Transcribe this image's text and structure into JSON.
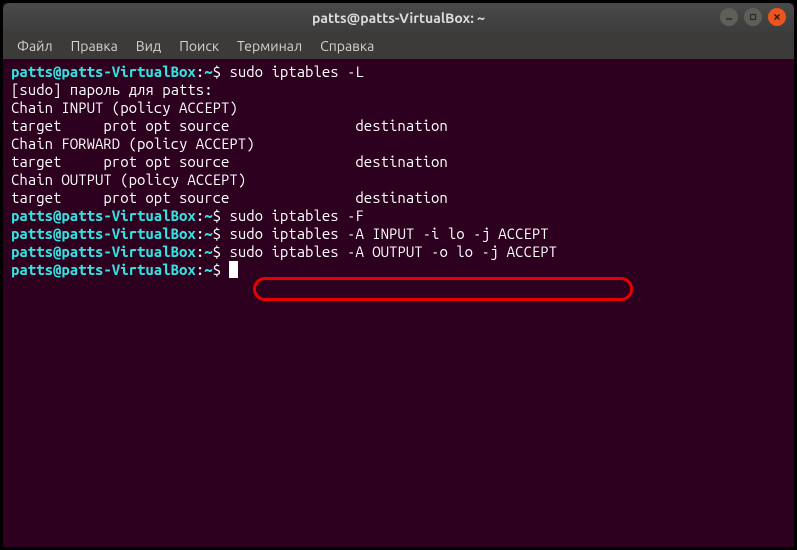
{
  "titlebar": {
    "title": "patts@patts-VirtualBox: ~"
  },
  "menubar": {
    "items": [
      "Файл",
      "Правка",
      "Вид",
      "Поиск",
      "Терминал",
      "Справка"
    ]
  },
  "prompt": {
    "user_host": "patts@patts-VirtualBox",
    "sep": ":",
    "path": "~",
    "sym": "$"
  },
  "lines": {
    "l0_cmd": "sudo iptables -L",
    "l1": "[sudo] пароль для patts:",
    "l2": "Chain INPUT (policy ACCEPT)",
    "l3": "target     prot opt source               destination",
    "l4": "",
    "l5": "Chain FORWARD (policy ACCEPT)",
    "l6": "target     prot opt source               destination",
    "l7": "",
    "l8": "Chain OUTPUT (policy ACCEPT)",
    "l9": "target     prot opt source               destination",
    "l10_cmd": "sudo iptables -F",
    "l11_cmd": "sudo iptables -A INPUT -i lo -j ACCEPT",
    "l12_cmd": "sudo iptables -A OUTPUT -o lo -j ACCEPT",
    "l13_cmd": ""
  },
  "window_controls": {
    "min": "minimize",
    "max": "maximize",
    "close": "close"
  }
}
